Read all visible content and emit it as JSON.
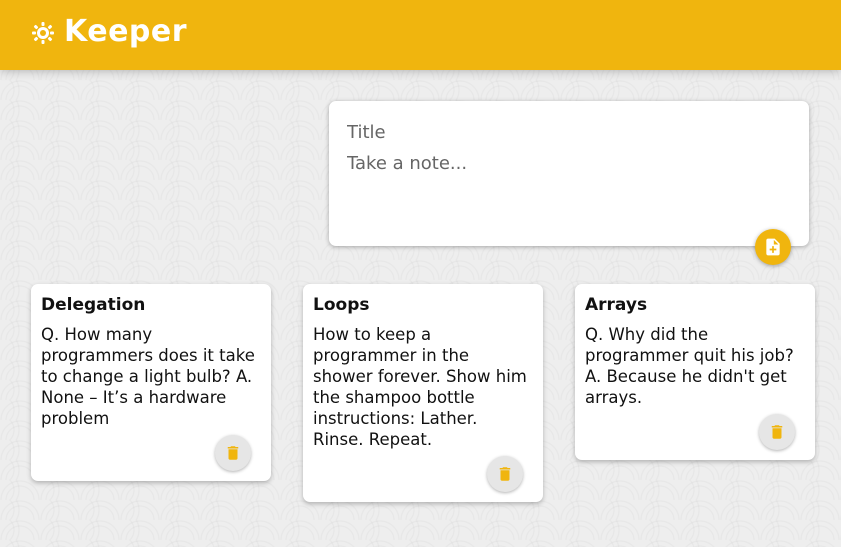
{
  "header": {
    "app_title": "Keeper",
    "logo_icon": "lightbulb-icon"
  },
  "create_area": {
    "title_placeholder": "Title",
    "content_placeholder": "Take a note...",
    "add_icon": "note-add-icon"
  },
  "notes": [
    {
      "title": "Delegation",
      "content": "Q. How many programmers does it take to change a light bulb? A. None – It’s a hardware problem",
      "delete_icon": "trash-icon"
    },
    {
      "title": "Loops",
      "content": "How to keep a programmer in the shower forever. Show him the shampoo bottle instructions: Lather. Rinse. Repeat.",
      "delete_icon": "trash-icon"
    },
    {
      "title": "Arrays",
      "content": "Q. Why did the programmer quit his job? A. Because he didn't get arrays.",
      "delete_icon": "trash-icon"
    }
  ],
  "colors": {
    "brand": "#f0b50e",
    "background": "#eeeeee",
    "card": "#ffffff"
  }
}
